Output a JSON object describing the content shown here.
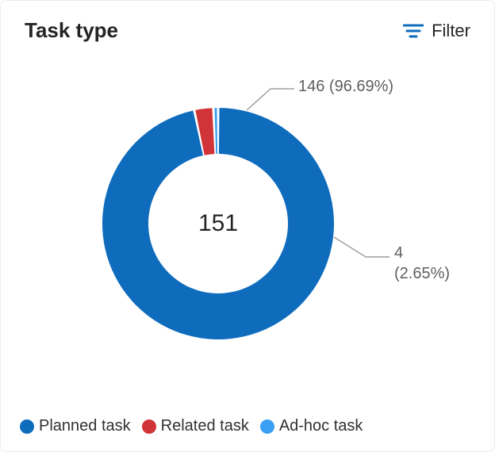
{
  "header": {
    "title": "Task type",
    "filter_label": "Filter"
  },
  "chart_data": {
    "type": "pie",
    "title": "Task type",
    "total_value": 151,
    "series": [
      {
        "name": "Planned task",
        "value": 146,
        "percent": 96.69,
        "color": "#0f6cbd",
        "callout": "146 (96.69%)"
      },
      {
        "name": "Related task",
        "value": 4,
        "percent": 2.65,
        "color": "#d13438",
        "callout": "4"
      },
      {
        "name": "Ad-hoc task",
        "value": 1,
        "percent": 0.66,
        "color": "#3aa0f3",
        "callout": "(2.65%)"
      }
    ],
    "legend": [
      {
        "label": "Planned task",
        "color": "#0f6cbd"
      },
      {
        "label": "Related task",
        "color": "#d13438"
      },
      {
        "label": "Ad-hoc task",
        "color": "#3aa0f3"
      }
    ],
    "callouts": {
      "top": "146 (96.69%)",
      "right_line1": "4",
      "right_line2": "(2.65%)"
    }
  }
}
